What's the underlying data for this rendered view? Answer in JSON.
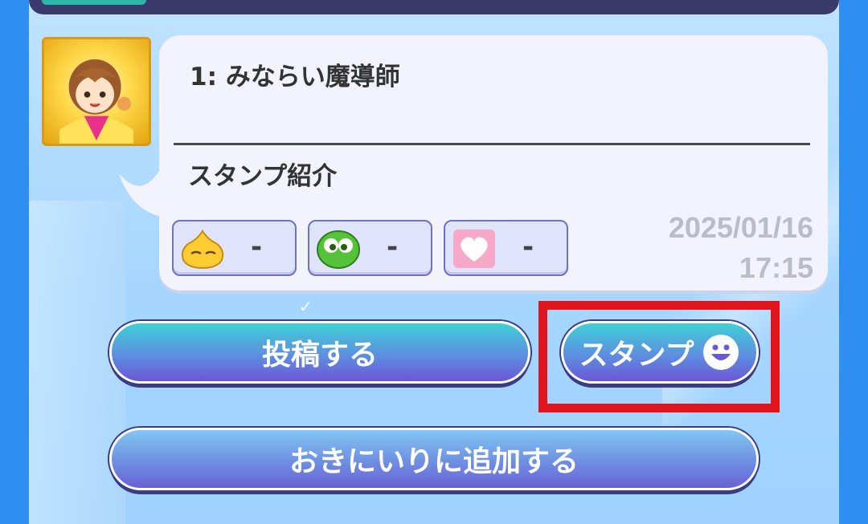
{
  "post": {
    "title": "1: みならい魔導師",
    "body": "スタンプ紹介",
    "date": "2025/01/16",
    "time": "17:15"
  },
  "stamps": [
    {
      "icon": "yellow-puyo-icon",
      "count": "-"
    },
    {
      "icon": "green-puyo-icon",
      "count": "-"
    },
    {
      "icon": "heart-icon",
      "count": "-"
    }
  ],
  "buttons": {
    "post": "投稿する",
    "stamp": "スタンプ",
    "favorite": "おきにいりに追加する"
  },
  "colors": {
    "highlight": "#e0141c",
    "button_top": "#3fd0d6",
    "button_bottom": "#6b57d6"
  }
}
